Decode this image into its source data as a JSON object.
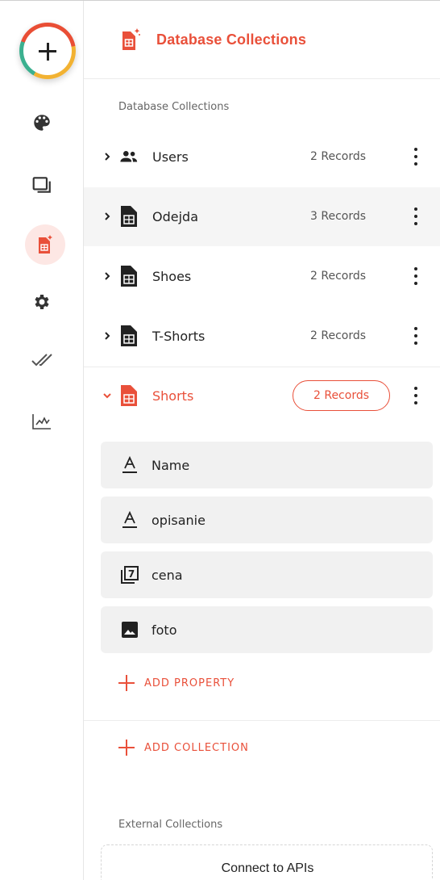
{
  "header": {
    "title": "Database Collections"
  },
  "sections": {
    "database_label": "Database Collections",
    "external_label": "External Collections"
  },
  "rail": {
    "items": [
      {
        "icon": "palette-icon"
      },
      {
        "icon": "screens-icon"
      },
      {
        "icon": "database-icon",
        "active": true
      },
      {
        "icon": "gear-icon"
      },
      {
        "icon": "double-check-icon"
      },
      {
        "icon": "analytics-icon"
      }
    ]
  },
  "collections": [
    {
      "name": "Users",
      "count": "2 Records",
      "icon": "users-icon"
    },
    {
      "name": "Odejda",
      "count": "3 Records",
      "icon": "table-icon"
    },
    {
      "name": "Shoes",
      "count": "2 Records",
      "icon": "table-icon"
    },
    {
      "name": "T-Shorts",
      "count": "2 Records",
      "icon": "table-icon"
    },
    {
      "name": "Shorts",
      "count": "2 Records",
      "icon": "table-icon",
      "expanded": true
    }
  ],
  "properties": [
    {
      "name": "Name",
      "icon": "text-type-icon"
    },
    {
      "name": "opisanie",
      "icon": "text-type-icon"
    },
    {
      "name": "cena",
      "icon": "number-type-icon",
      "glyph": "7"
    },
    {
      "name": "foto",
      "icon": "image-type-icon"
    }
  ],
  "actions": {
    "add_property": "ADD PROPERTY",
    "add_collection": "ADD COLLECTION",
    "connect_apis": "Connect to APIs"
  },
  "colors": {
    "accent": "#e9503a",
    "highlight": "#f5f5f5",
    "property_bg": "#f1f1f1"
  }
}
